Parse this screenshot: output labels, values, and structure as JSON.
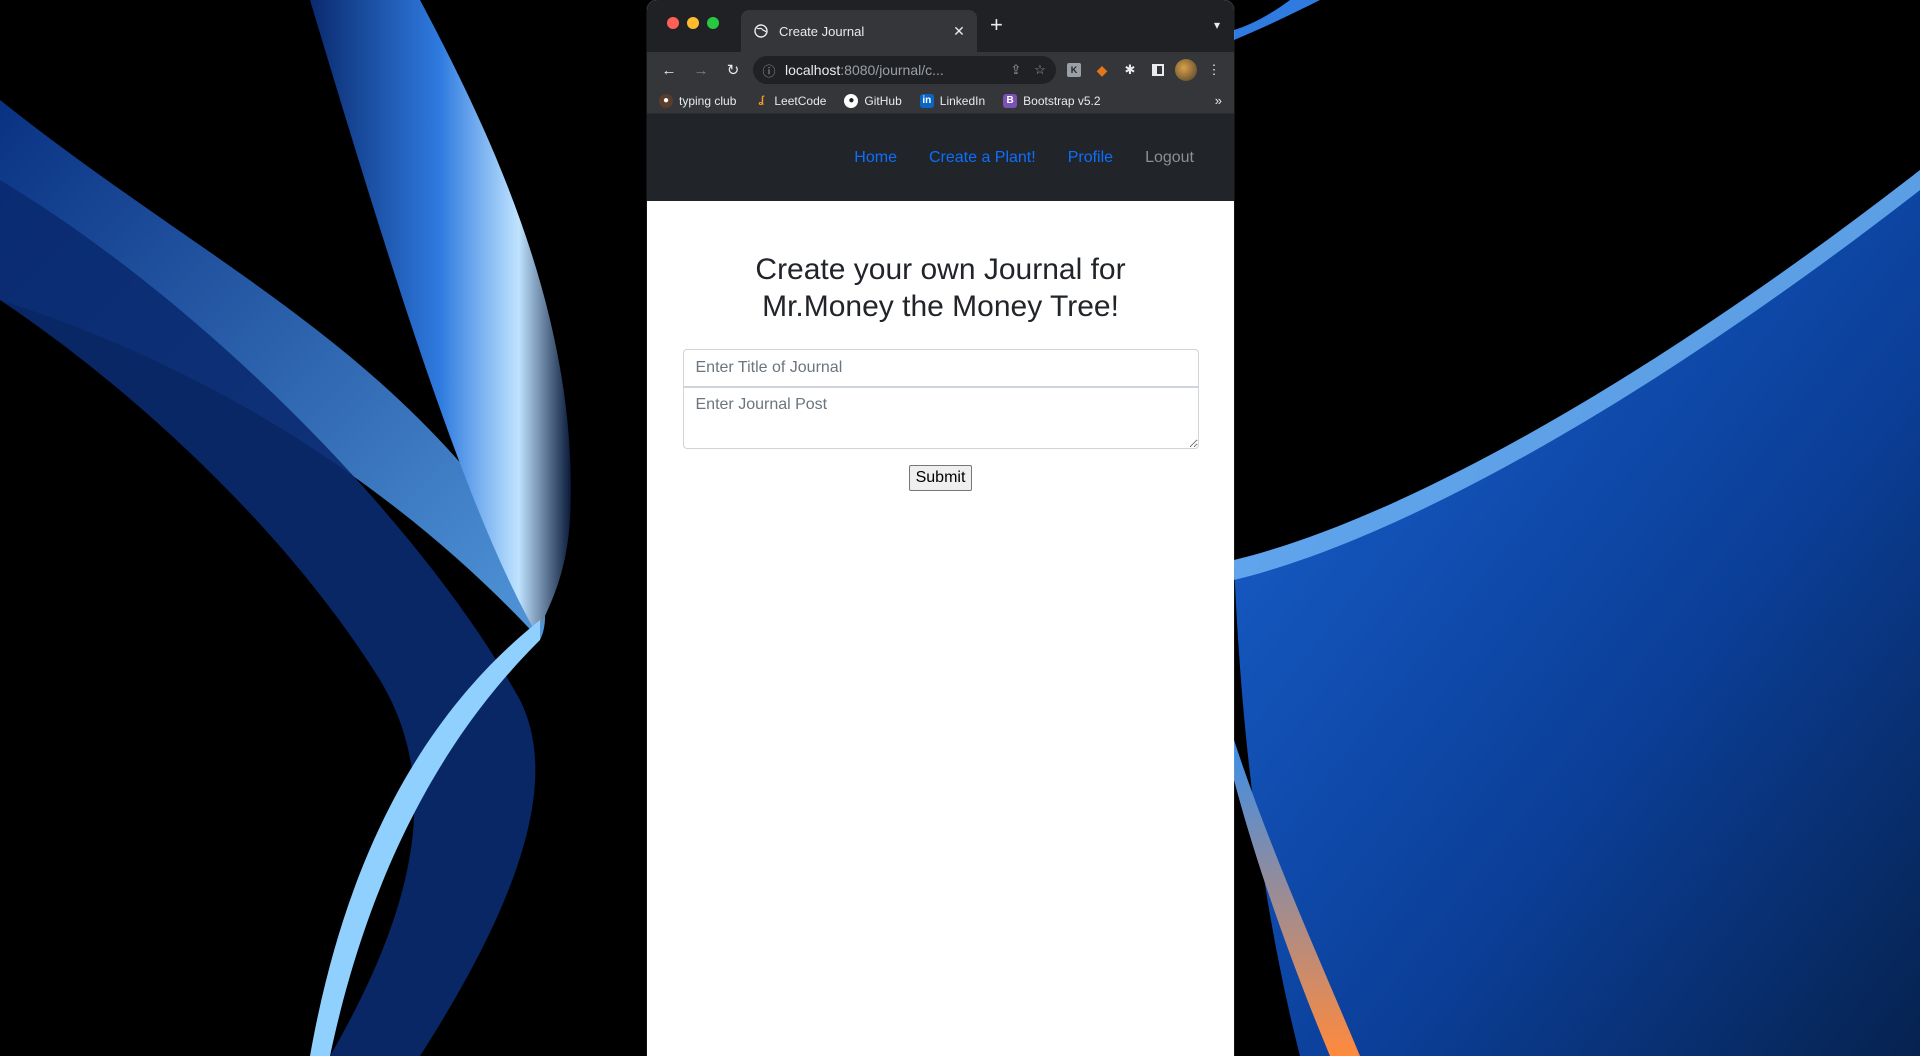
{
  "browser": {
    "tab_title": "Create Journal",
    "new_tab": "+",
    "url_host": "localhost",
    "url_path": ":8080/journal/c..."
  },
  "bookmarks": [
    {
      "label": "typing club",
      "icon": "typing-club-icon",
      "color": "#e8a33d"
    },
    {
      "label": "LeetCode",
      "icon": "leetcode-icon",
      "color": "#f89f1b"
    },
    {
      "label": "GitHub",
      "icon": "github-icon",
      "color": "#ffffff"
    },
    {
      "label": "LinkedIn",
      "icon": "linkedin-icon",
      "color": "#0a66c2"
    },
    {
      "label": "Bootstrap v5.2",
      "icon": "bootstrap-icon",
      "color": "#7952b3"
    }
  ],
  "navbar": {
    "items": [
      {
        "label": "Home"
      },
      {
        "label": "Create a Plant!"
      },
      {
        "label": "Profile"
      },
      {
        "label": "Logout"
      }
    ]
  },
  "page": {
    "heading": "Create your own Journal for Mr.Money the Money Tree!",
    "title_placeholder": "Enter Title of Journal",
    "post_placeholder": "Enter Journal Post",
    "submit_label": "Submit"
  },
  "colors": {
    "nav_link": "#0d6efd",
    "nav_bg": "#212529"
  }
}
